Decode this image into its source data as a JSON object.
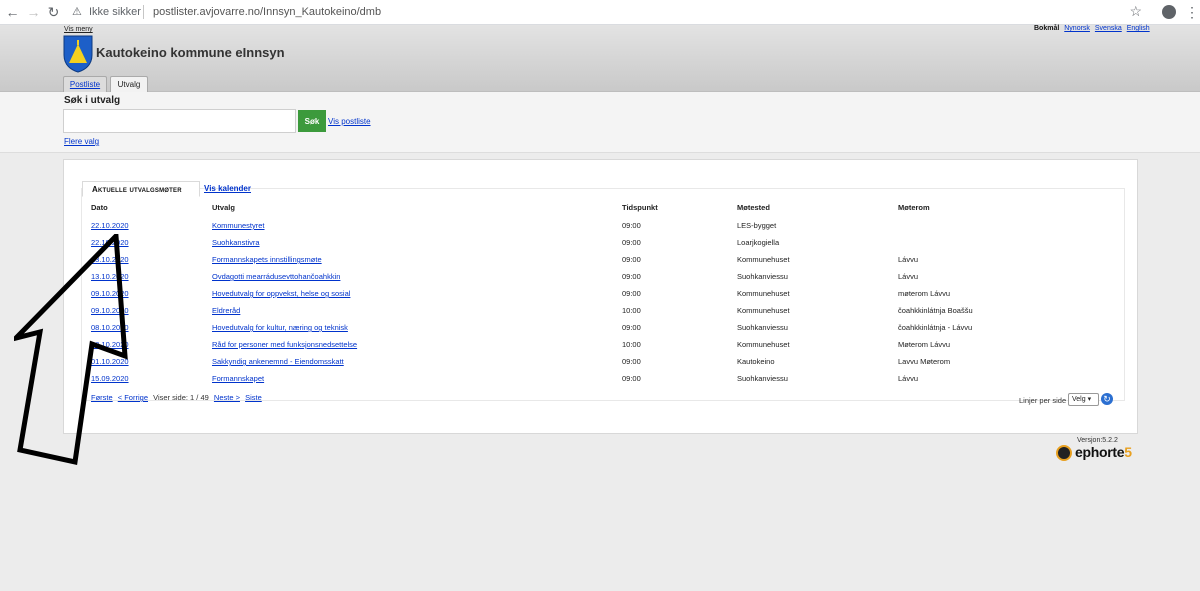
{
  "browser": {
    "security_label": "Ikke sikker",
    "url": "postlister.avjovarre.no/Innsyn_Kautokeino/dmb"
  },
  "header": {
    "vis_meny": "Vis meny",
    "title": "Kautokeino kommune eInnsyn",
    "languages": {
      "current": "Bokmål",
      "others": [
        "Nynorsk",
        "Svenska",
        "English"
      ]
    },
    "tabs": [
      "Postliste",
      "Utvalg"
    ]
  },
  "search": {
    "heading": "Søk i utvalg",
    "input_value": "",
    "button_label": "Søk",
    "vis_postliste": "Vis postliste",
    "flere_valg": "Flere valg"
  },
  "panel": {
    "tabs": {
      "active": "Aktuelle utvalgsmøter",
      "kalender": "Vis kalender"
    },
    "columns": [
      "Dato",
      "Utvalg",
      "Tidspunkt",
      "Møtested",
      "Møterom"
    ],
    "rows": [
      {
        "dato": "22.10.2020",
        "utvalg": "Kommunestyret",
        "tid": "09:00",
        "sted": "LES-bygget",
        "rom": ""
      },
      {
        "dato": "22.10.2020",
        "utvalg": "Suohkanstivra",
        "tid": "09:00",
        "sted": "Loarjkogiella",
        "rom": ""
      },
      {
        "dato": "13.10.2020",
        "utvalg": "Formannskapets innstillingsmøte",
        "tid": "09:00",
        "sted": "Kommunehuset",
        "rom": "Lávvu"
      },
      {
        "dato": "13.10.2020",
        "utvalg": "Ovdagotti mearrádusevttohančoahkkin",
        "tid": "09:00",
        "sted": "Suohkanviessu",
        "rom": "Lávvu"
      },
      {
        "dato": "09.10.2020",
        "utvalg": "Hovedutvalg for oppvekst, helse og sosial",
        "tid": "09:00",
        "sted": "Kommunehuset",
        "rom": "møterom Lávvu"
      },
      {
        "dato": "09.10.2020",
        "utvalg": "Eldreråd",
        "tid": "10:00",
        "sted": "Kommunehuset",
        "rom": "čoahkkinlátnja Boaššu"
      },
      {
        "dato": "08.10.2020",
        "utvalg": "Hovedutvalg for kultur, næring og teknisk",
        "tid": "09:00",
        "sted": "Suohkanviessu",
        "rom": "čoahkkinlátnja - Lávvu"
      },
      {
        "dato": "08.10.2020",
        "utvalg": "Råd for personer med funksjonsnedsettelse",
        "tid": "10:00",
        "sted": "Kommunehuset",
        "rom": "Møterom Lávvu"
      },
      {
        "dato": "01.10.2020",
        "utvalg": "Sakkyndig ankenemnd - Eiendomsskatt",
        "tid": "09:00",
        "sted": "Kautokeino",
        "rom": "Lavvu Møterom"
      },
      {
        "dato": "15.09.2020",
        "utvalg": "Formannskapet",
        "tid": "09:00",
        "sted": "Suohkanviessu",
        "rom": "Lávvu"
      }
    ],
    "pager": {
      "first": "Første",
      "prev": "< Forrige",
      "status": "Viser side: 1 / 49",
      "next": "Neste >",
      "last": "Siste"
    },
    "lines_per_page_label": "Linjer per side",
    "lines_per_page_value": "Velg"
  },
  "footer": {
    "version": "Versjon:5.2.2",
    "brand_text": "ephorte",
    "brand_num": "5"
  },
  "colors": {
    "link": "#0033cc",
    "search_button": "#3c9a3c",
    "brand_orange": "#e8a020"
  }
}
